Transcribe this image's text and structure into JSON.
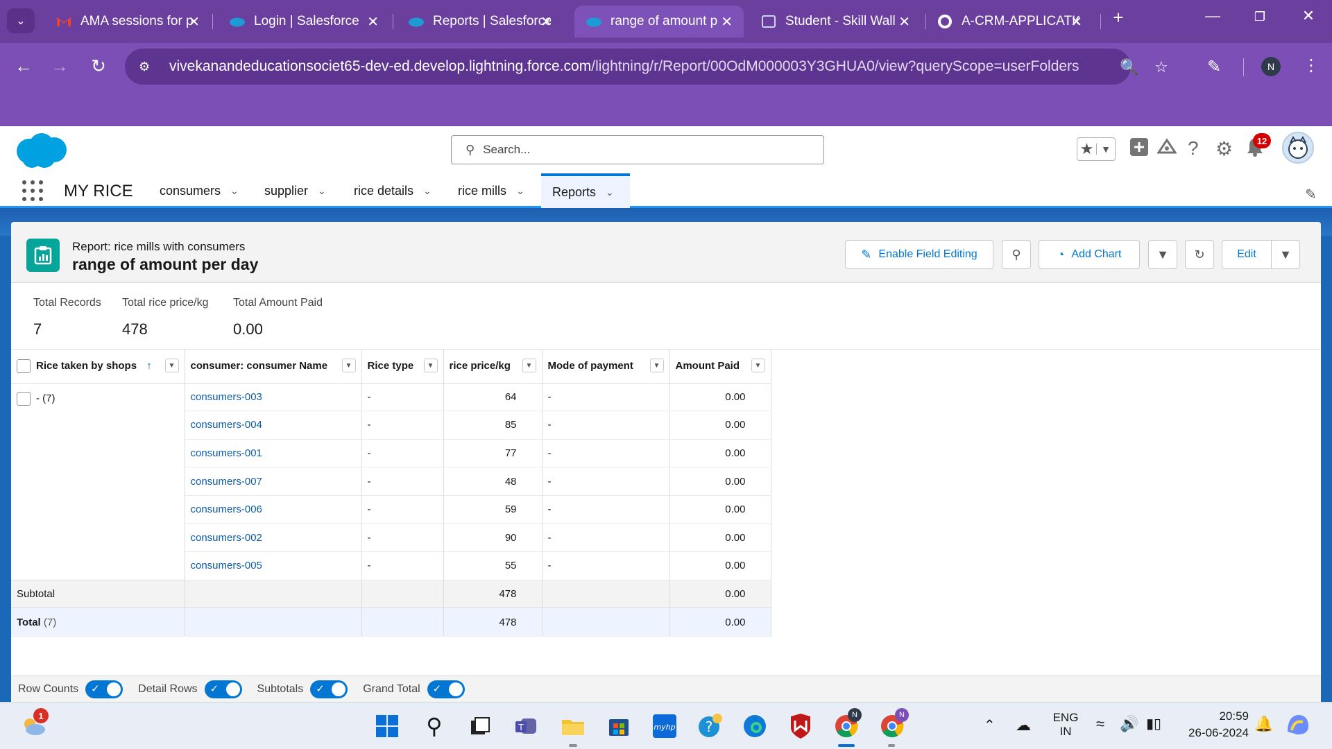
{
  "browser": {
    "tabs": [
      {
        "title": "AMA sessions for p",
        "icon": "gmail-icon"
      },
      {
        "title": "Login | Salesforce",
        "icon": "salesforce-icon"
      },
      {
        "title": "Reports | Salesforce",
        "icon": "salesforce-icon"
      },
      {
        "title": "range of amount p",
        "icon": "salesforce-icon",
        "active": true
      },
      {
        "title": "Student - Skill Wall",
        "icon": "page-icon"
      },
      {
        "title": "A-CRM-APPLICATIO",
        "icon": "github-icon"
      }
    ],
    "url_host": "vivekanandeducationsociet65-dev-ed.develop.lightning.force.com",
    "url_path": "/lightning/r/Report/00OdM000003Y3GHUA0/view?queryScope=userFolders",
    "profile_initial": "N"
  },
  "sf": {
    "search_placeholder": "Search...",
    "notification_count": "12",
    "app_name": "MY RICE",
    "nav": [
      {
        "label": "consumers"
      },
      {
        "label": "supplier"
      },
      {
        "label": "rice details"
      },
      {
        "label": "rice mills"
      },
      {
        "label": "Reports",
        "active": true
      }
    ]
  },
  "report": {
    "kind": "Report: rice mills with consumers",
    "title": "range of amount per day",
    "buttons": {
      "enable_field_editing": "Enable Field Editing",
      "add_chart": "Add Chart",
      "edit": "Edit"
    },
    "summary": [
      {
        "label": "Total Records",
        "value": "7"
      },
      {
        "label": "Total rice price/kg",
        "value": "478"
      },
      {
        "label": "Total Amount Paid",
        "value": "0.00"
      }
    ],
    "columns": [
      "Rice taken by shops",
      "consumer: consumer Name",
      "Rice type",
      "rice price/kg",
      "Mode of payment",
      "Amount Paid"
    ],
    "group_label": "- (7)",
    "rows": [
      {
        "name": "consumers-003",
        "type": "-",
        "price": "64",
        "mode": "-",
        "paid": "0.00"
      },
      {
        "name": "consumers-004",
        "type": "-",
        "price": "85",
        "mode": "-",
        "paid": "0.00"
      },
      {
        "name": "consumers-001",
        "type": "-",
        "price": "77",
        "mode": "-",
        "paid": "0.00"
      },
      {
        "name": "consumers-007",
        "type": "-",
        "price": "48",
        "mode": "-",
        "paid": "0.00"
      },
      {
        "name": "consumers-006",
        "type": "-",
        "price": "59",
        "mode": "-",
        "paid": "0.00"
      },
      {
        "name": "consumers-002",
        "type": "-",
        "price": "90",
        "mode": "-",
        "paid": "0.00"
      },
      {
        "name": "consumers-005",
        "type": "-",
        "price": "55",
        "mode": "-",
        "paid": "0.00"
      }
    ],
    "subtotal": {
      "label": "Subtotal",
      "price": "478",
      "paid": "0.00"
    },
    "total": {
      "label": "Total",
      "count": "(7)",
      "price": "478",
      "paid": "0.00"
    },
    "toggles": [
      "Row Counts",
      "Detail Rows",
      "Subtotals",
      "Grand Total"
    ]
  },
  "taskbar": {
    "weather_badge": "1",
    "lang": "ENG",
    "region": "IN",
    "time": "20:59",
    "date": "26-06-2024"
  },
  "colors": {
    "browser_tabbar": "#6a3f9e",
    "browser_toolbar": "#7b4fb5",
    "sf_brand": "#0176d3",
    "report_icon": "#06a59a"
  }
}
